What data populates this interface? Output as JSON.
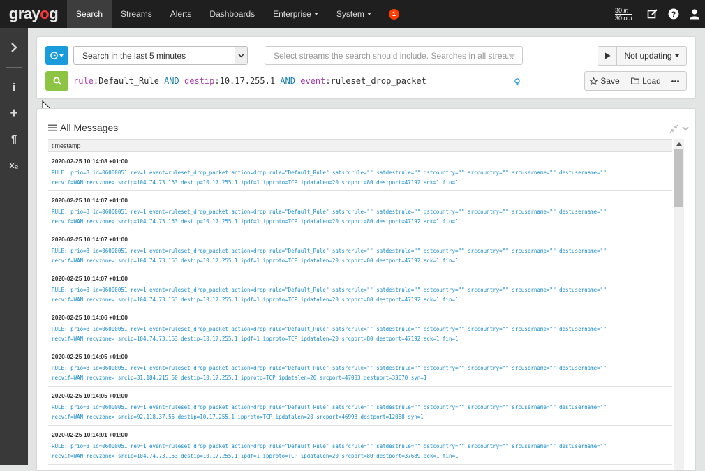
{
  "navbar": {
    "logo_pre": "gray",
    "logo_o": "o",
    "logo_post": "g",
    "items": [
      {
        "label": "Search",
        "active": true
      },
      {
        "label": "Streams"
      },
      {
        "label": "Alerts"
      },
      {
        "label": "Dashboards"
      },
      {
        "label": "Enterprise",
        "dropdown": true
      },
      {
        "label": "System",
        "dropdown": true
      }
    ],
    "notification_count": "1",
    "throughput_in_value": "30",
    "throughput_in_unit": "in",
    "throughput_out_value": "30",
    "throughput_out_unit": "out"
  },
  "sidebar": {
    "expand_icon": "chevron-right-icon",
    "items": [
      {
        "glyph": "i",
        "icon": "info-icon"
      },
      {
        "glyph": "+",
        "icon": "plus-icon"
      },
      {
        "glyph": "¶",
        "icon": "paragraph-icon"
      },
      {
        "glyph": "x₂",
        "icon": "subscript-icon"
      }
    ]
  },
  "search": {
    "range_value": "Search in the last 5 minutes",
    "streams_placeholder": "Select streams the search should include. Searches in all strea...",
    "updating_label": "Not updating",
    "query": {
      "f1": "rule",
      "v1": "Default_Rule",
      "op1": "AND",
      "f2": "destip",
      "v2": "10.17.255.1",
      "op2": "AND",
      "f3": "event",
      "v3": "ruleset_drop_packet"
    },
    "save_label": "Save",
    "load_label": "Load"
  },
  "messages": {
    "title": "All Messages",
    "column_header": "timestamp",
    "rows": [
      {
        "timestamp": "2020-02-25 10:14:08 +01:00",
        "line1": "RULE: prio=3 id=06000051 rev=1 event=ruleset_drop_packet action=drop rule=\"Default_Rule\" satsrcrule=\"\" satdestrule=\"\" dstcountry=\"\" srccountry=\"\" srcusername=\"\" destusername=\"\"",
        "line2": "recvif=WAN recvzone= srcip=104.74.73.153 destip=10.17.255.1 ipdf=1 ipproto=TCP ipdatalen=20 srcport=80 destport=47192 ack=1 fin=1"
      },
      {
        "timestamp": "2020-02-25 10:14:07 +01:00",
        "line1": "RULE: prio=3 id=06000051 rev=1 event=ruleset_drop_packet action=drop rule=\"Default_Rule\" satsrcrule=\"\" satdestrule=\"\" dstcountry=\"\" srccountry=\"\" srcusername=\"\" destusername=\"\"",
        "line2": "recvif=WAN recvzone= srcip=104.74.73.153 destip=10.17.255.1 ipdf=1 ipproto=TCP ipdatalen=20 srcport=80 destport=47192 ack=1 fin=1"
      },
      {
        "timestamp": "2020-02-25 10:14:07 +01:00",
        "line1": "RULE: prio=3 id=06000051 rev=1 event=ruleset_drop_packet action=drop rule=\"Default_Rule\" satsrcrule=\"\" satdestrule=\"\" dstcountry=\"\" srccountry=\"\" srcusername=\"\" destusername=\"\"",
        "line2": "recvif=WAN recvzone= srcip=104.74.73.153 destip=10.17.255.1 ipdf=1 ipproto=TCP ipdatalen=20 srcport=80 destport=47192 ack=1 fin=1"
      },
      {
        "timestamp": "2020-02-25 10:14:07 +01:00",
        "line1": "RULE: prio=3 id=06000051 rev=1 event=ruleset_drop_packet action=drop rule=\"Default_Rule\" satsrcrule=\"\" satdestrule=\"\" dstcountry=\"\" srccountry=\"\" srcusername=\"\" destusername=\"\"",
        "line2": "recvif=WAN recvzone= srcip=104.74.73.153 destip=10.17.255.1 ipdf=1 ipproto=TCP ipdatalen=20 srcport=80 destport=47192 ack=1 fin=1"
      },
      {
        "timestamp": "2020-02-25 10:14:06 +01:00",
        "line1": "RULE: prio=3 id=06000051 rev=1 event=ruleset_drop_packet action=drop rule=\"Default_Rule\" satsrcrule=\"\" satdestrule=\"\" dstcountry=\"\" srccountry=\"\" srcusername=\"\" destusername=\"\"",
        "line2": "recvif=WAN recvzone= srcip=104.74.73.153 destip=10.17.255.1 ipdf=1 ipproto=TCP ipdatalen=20 srcport=80 destport=47192 ack=1 fin=1"
      },
      {
        "timestamp": "2020-02-25 10:14:05 +01:00",
        "line1": "RULE: prio=3 id=06000051 rev=1 event=ruleset_drop_packet action=drop rule=\"Default_Rule\" satsrcrule=\"\" satdestrule=\"\" dstcountry=\"\" srccountry=\"\" srcusername=\"\" destusername=\"\"",
        "line2": "recvif=WAN recvzone= srcip=31.184.215.50 destip=10.17.255.1 ipproto=TCP ipdatalen=20 srcport=47003 destport=33670 syn=1"
      },
      {
        "timestamp": "2020-02-25 10:14:05 +01:00",
        "line1": "RULE: prio=3 id=06000051 rev=1 event=ruleset_drop_packet action=drop rule=\"Default_Rule\" satsrcrule=\"\" satdestrule=\"\" dstcountry=\"\" srccountry=\"\" srcusername=\"\" destusername=\"\"",
        "line2": "recvif=WAN recvzone= srcip=92.118.37.55 destip=10.17.255.1 ipproto=TCP ipdatalen=20 srcport=46993 destport=12088 syn=1"
      },
      {
        "timestamp": "2020-02-25 10:14:01 +01:00",
        "line1": "RULE: prio=3 id=06000051 rev=1 event=ruleset_drop_packet action=drop rule=\"Default_Rule\" satsrcrule=\"\" satdestrule=\"\" dstcountry=\"\" srccountry=\"\" srcusername=\"\" destusername=\"\"",
        "line2": "recvif=WAN recvzone= srcip=104.74.73.153 destip=10.17.255.1 ipdf=1 ipproto=TCP ipdatalen=20 srcport=80 destport=37689 ack=1 fin=1"
      }
    ]
  },
  "colors": {
    "navbar_bg": "#1f1f1f",
    "logo_accent": "#ff3633",
    "range_button": "#1a9bdb",
    "search_button": "#8dc444",
    "message_text": "#1a8bc8",
    "query_field": "#a23ca8",
    "query_operator": "#1a7ea8",
    "badge": "#ff3b00"
  }
}
